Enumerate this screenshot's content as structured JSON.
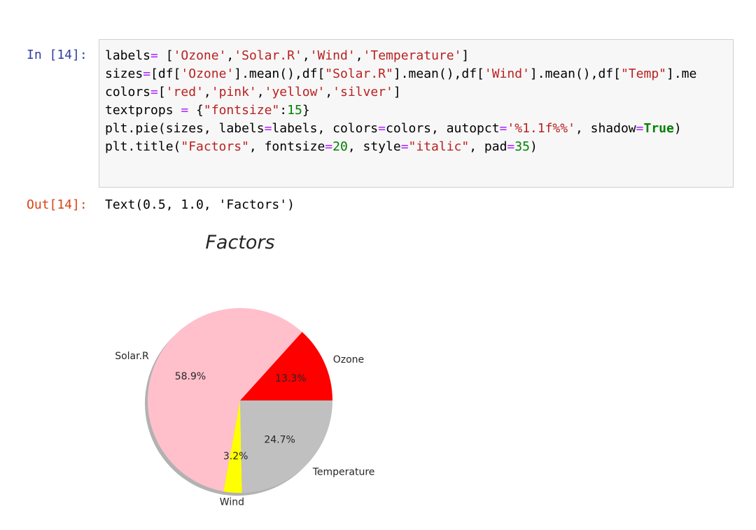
{
  "notebook": {
    "in_prompt": "In [14]:",
    "out_prompt": "Out[14]:",
    "output_text": "Text(0.5, 1.0, 'Factors')",
    "code_lines": [
      [
        {
          "t": "labels",
          "c": ""
        },
        {
          "t": "=",
          "c": "op"
        },
        {
          "t": " [",
          "c": ""
        },
        {
          "t": "'Ozone'",
          "c": "str"
        },
        {
          "t": ",",
          "c": ""
        },
        {
          "t": "'Solar.R'",
          "c": "str"
        },
        {
          "t": ",",
          "c": ""
        },
        {
          "t": "'Wind'",
          "c": "str"
        },
        {
          "t": ",",
          "c": ""
        },
        {
          "t": "'Temperature'",
          "c": "str"
        },
        {
          "t": "]",
          "c": ""
        }
      ],
      [
        {
          "t": "sizes",
          "c": ""
        },
        {
          "t": "=",
          "c": "op"
        },
        {
          "t": "[df[",
          "c": ""
        },
        {
          "t": "'Ozone'",
          "c": "str"
        },
        {
          "t": "].mean(),df[",
          "c": ""
        },
        {
          "t": "\"Solar.R\"",
          "c": "str"
        },
        {
          "t": "].mean(),df[",
          "c": ""
        },
        {
          "t": "'Wind'",
          "c": "str"
        },
        {
          "t": "].mean(),df[",
          "c": ""
        },
        {
          "t": "\"Temp\"",
          "c": "str"
        },
        {
          "t": "].me",
          "c": ""
        }
      ],
      [
        {
          "t": "colors",
          "c": ""
        },
        {
          "t": "=",
          "c": "op"
        },
        {
          "t": "[",
          "c": ""
        },
        {
          "t": "'red'",
          "c": "str"
        },
        {
          "t": ",",
          "c": ""
        },
        {
          "t": "'pink'",
          "c": "str"
        },
        {
          "t": ",",
          "c": ""
        },
        {
          "t": "'yellow'",
          "c": "str"
        },
        {
          "t": ",",
          "c": ""
        },
        {
          "t": "'silver'",
          "c": "str"
        },
        {
          "t": "]",
          "c": ""
        }
      ],
      [
        {
          "t": "textprops ",
          "c": ""
        },
        {
          "t": "=",
          "c": "op"
        },
        {
          "t": " {",
          "c": ""
        },
        {
          "t": "\"fontsize\"",
          "c": "str"
        },
        {
          "t": ":",
          "c": ""
        },
        {
          "t": "15",
          "c": "num"
        },
        {
          "t": "}",
          "c": ""
        }
      ],
      [
        {
          "t": "plt.pie(sizes, labels",
          "c": ""
        },
        {
          "t": "=",
          "c": "op"
        },
        {
          "t": "labels, colors",
          "c": ""
        },
        {
          "t": "=",
          "c": "op"
        },
        {
          "t": "colors, autopct",
          "c": ""
        },
        {
          "t": "=",
          "c": "op"
        },
        {
          "t": "'%1.1f%%'",
          "c": "str"
        },
        {
          "t": ", shadow",
          "c": ""
        },
        {
          "t": "=",
          "c": "op"
        },
        {
          "t": "True",
          "c": "kw"
        },
        {
          "t": ")",
          "c": ""
        }
      ],
      [
        {
          "t": "plt.title(",
          "c": ""
        },
        {
          "t": "\"Factors\"",
          "c": "str"
        },
        {
          "t": ", fontsize",
          "c": ""
        },
        {
          "t": "=",
          "c": "op"
        },
        {
          "t": "20",
          "c": "num"
        },
        {
          "t": ", style",
          "c": ""
        },
        {
          "t": "=",
          "c": "op"
        },
        {
          "t": "\"italic\"",
          "c": "str"
        },
        {
          "t": ", pad",
          "c": ""
        },
        {
          "t": "=",
          "c": "op"
        },
        {
          "t": "35",
          "c": "num"
        },
        {
          "t": ")",
          "c": ""
        }
      ]
    ]
  },
  "chart_data": {
    "type": "pie",
    "title": "Factors",
    "categories": [
      "Ozone",
      "Solar.R",
      "Wind",
      "Temperature"
    ],
    "values": [
      13.3,
      58.9,
      3.2,
      24.7
    ],
    "autopct_labels": [
      "13.3%",
      "58.9%",
      "3.2%",
      "24.7%"
    ],
    "colors": [
      "#ff0000",
      "#ffc0cb",
      "#ffff00",
      "#c0c0c0"
    ],
    "shadow": true,
    "start_angle_deg": 0,
    "direction": "counterclockwise"
  }
}
